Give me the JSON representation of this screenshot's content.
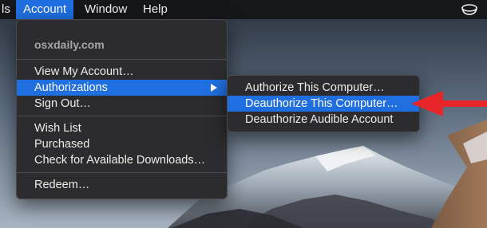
{
  "menubar": {
    "items": [
      {
        "label": "ls",
        "active": false
      },
      {
        "label": "Account",
        "active": true
      },
      {
        "label": "Window",
        "active": false
      },
      {
        "label": "Help",
        "active": false
      }
    ],
    "extra_icon": "cup-icon"
  },
  "account_menu": {
    "header": "osxdaily.com",
    "items": [
      {
        "label": "View My Account…"
      },
      {
        "label": "Authorizations",
        "selected": true,
        "has_submenu": true
      },
      {
        "label": "Sign Out…"
      },
      {
        "label": "Wish List"
      },
      {
        "label": "Purchased"
      },
      {
        "label": "Check for Available Downloads…"
      },
      {
        "label": "Redeem…"
      }
    ]
  },
  "authorizations_submenu": {
    "items": [
      {
        "label": "Authorize This Computer…"
      },
      {
        "label": "Deauthorize This Computer…",
        "selected": true
      },
      {
        "label": "Deauthorize Audible Account"
      }
    ]
  },
  "annotation": {
    "icon": "red-arrow-icon",
    "color": "#e8262a"
  },
  "colors": {
    "highlight": "#1f6fe0",
    "menu_bg": "#2c2c2e",
    "menubar_bg": "#16171a"
  }
}
